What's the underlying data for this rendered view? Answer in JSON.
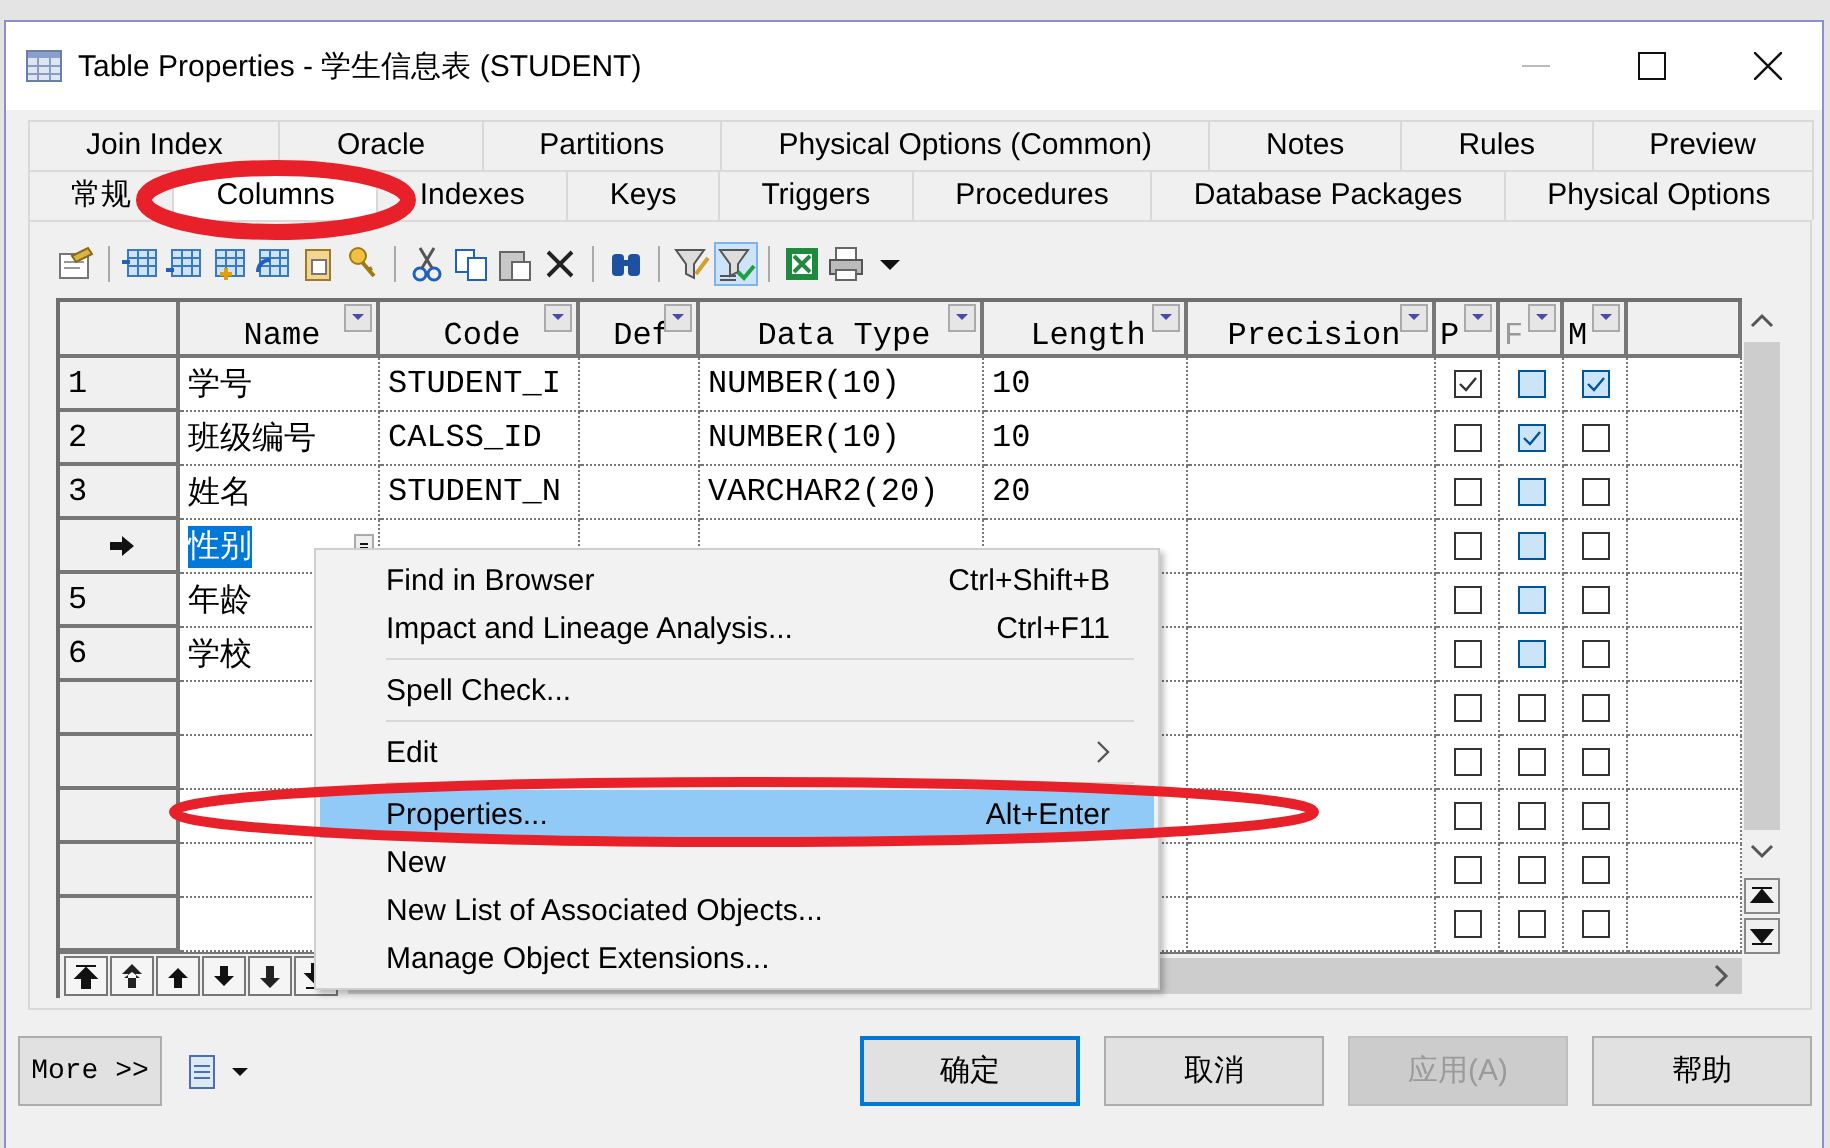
{
  "window": {
    "title": "Table Properties - 学生信息表 (STUDENT)"
  },
  "tab_rows": [
    [
      {
        "label": "Join Index",
        "selected": false
      },
      {
        "label": "Oracle",
        "selected": false
      },
      {
        "label": "Partitions",
        "selected": false
      },
      {
        "label": "Physical Options (Common)",
        "selected": false
      },
      {
        "label": "Notes",
        "selected": false
      },
      {
        "label": "Rules",
        "selected": false
      },
      {
        "label": "Preview",
        "selected": false
      }
    ],
    [
      {
        "label": "常规",
        "selected": false
      },
      {
        "label": "Columns",
        "selected": true
      },
      {
        "label": "Indexes",
        "selected": false
      },
      {
        "label": "Keys",
        "selected": false
      },
      {
        "label": "Triggers",
        "selected": false
      },
      {
        "label": "Procedures",
        "selected": false
      },
      {
        "label": "Database Packages",
        "selected": false
      },
      {
        "label": "Physical Options",
        "selected": false
      }
    ]
  ],
  "toolbar": {
    "filter_active": true
  },
  "grid": {
    "columns": [
      {
        "label": "Name",
        "disabled": false
      },
      {
        "label": "Code",
        "disabled": false
      },
      {
        "label": "Def",
        "disabled": false
      },
      {
        "label": "Data Type",
        "disabled": false
      },
      {
        "label": "Length",
        "disabled": false
      },
      {
        "label": "Precision",
        "disabled": false
      },
      {
        "label": "P",
        "disabled": false
      },
      {
        "label": "F",
        "disabled": true
      },
      {
        "label": "M",
        "disabled": false
      }
    ],
    "rows": [
      {
        "number": "1",
        "current": false,
        "name": "学号",
        "code": "STUDENT_I",
        "data_type": "NUMBER(10)",
        "length": "10",
        "flags": [
          {
            "checked": true,
            "shaded": false
          },
          {
            "checked": false,
            "shaded": true
          },
          {
            "checked": true,
            "shaded": true
          }
        ]
      },
      {
        "number": "2",
        "current": false,
        "name": "班级编号",
        "code": "CALSS_ID",
        "data_type": "NUMBER(10)",
        "length": "10",
        "flags": [
          {
            "checked": false,
            "shaded": false
          },
          {
            "checked": true,
            "shaded": true
          },
          {
            "checked": false,
            "shaded": false
          }
        ]
      },
      {
        "number": "3",
        "current": false,
        "name": "姓名",
        "code": "STUDENT_N",
        "data_type": "VARCHAR2(20)",
        "length": "20",
        "flags": [
          {
            "checked": false,
            "shaded": false
          },
          {
            "checked": false,
            "shaded": true
          },
          {
            "checked": false,
            "shaded": false
          }
        ]
      },
      {
        "current": true,
        "name": "性别",
        "flags": [
          {
            "checked": false,
            "shaded": false
          },
          {
            "checked": false,
            "shaded": true
          },
          {
            "checked": false,
            "shaded": false
          }
        ]
      },
      {
        "number": "5",
        "current": false,
        "name": "年龄",
        "flags": [
          {
            "checked": false,
            "shaded": false
          },
          {
            "checked": false,
            "shaded": true
          },
          {
            "checked": false,
            "shaded": false
          }
        ]
      },
      {
        "number": "6",
        "current": false,
        "name": "学校",
        "flags": [
          {
            "checked": false,
            "shaded": false
          },
          {
            "checked": false,
            "shaded": true
          },
          {
            "checked": false,
            "shaded": false
          }
        ]
      },
      {
        "current": false,
        "flags": [
          {
            "checked": false,
            "shaded": false
          },
          {
            "checked": false,
            "shaded": false
          },
          {
            "checked": false,
            "shaded": false
          }
        ]
      },
      {
        "current": false,
        "flags": [
          {
            "checked": false,
            "shaded": false
          },
          {
            "checked": false,
            "shaded": false
          },
          {
            "checked": false,
            "shaded": false
          }
        ]
      },
      {
        "current": false,
        "flags": [
          {
            "checked": false,
            "shaded": false
          },
          {
            "checked": false,
            "shaded": false
          },
          {
            "checked": false,
            "shaded": false
          }
        ]
      },
      {
        "current": false,
        "flags": [
          {
            "checked": false,
            "shaded": false
          },
          {
            "checked": false,
            "shaded": false
          },
          {
            "checked": false,
            "shaded": false
          }
        ]
      },
      {
        "current": false,
        "flags": [
          {
            "checked": false,
            "shaded": false
          },
          {
            "checked": false,
            "shaded": false
          },
          {
            "checked": false,
            "shaded": false
          }
        ]
      }
    ]
  },
  "context_menu": {
    "items": [
      {
        "kind": "item",
        "label": "Find in Browser",
        "shortcut": "Ctrl+Shift+B",
        "selected": false
      },
      {
        "kind": "item",
        "label": "Impact and Lineage Analysis...",
        "shortcut": "Ctrl+F11",
        "selected": false
      },
      {
        "kind": "separator"
      },
      {
        "kind": "item",
        "label": "Spell Check...",
        "selected": false
      },
      {
        "kind": "separator"
      },
      {
        "kind": "submenu",
        "label": "Edit",
        "selected": false
      },
      {
        "kind": "separator"
      },
      {
        "kind": "item",
        "label": "Properties...",
        "shortcut": "Alt+Enter",
        "selected": true
      },
      {
        "kind": "item",
        "label": "New",
        "selected": false
      },
      {
        "kind": "item",
        "label": "New List of Associated Objects...",
        "selected": false
      },
      {
        "kind": "item",
        "label": "Manage Object Extensions...",
        "selected": false
      }
    ]
  },
  "footer": {
    "more_button": "More >>",
    "buttons": [
      {
        "label": "确定",
        "default": true,
        "disabled": false
      },
      {
        "label": "取消",
        "default": false,
        "disabled": false
      },
      {
        "label": "应用(A)",
        "default": false,
        "disabled": true
      },
      {
        "label": "帮助",
        "default": false,
        "disabled": false
      }
    ]
  }
}
